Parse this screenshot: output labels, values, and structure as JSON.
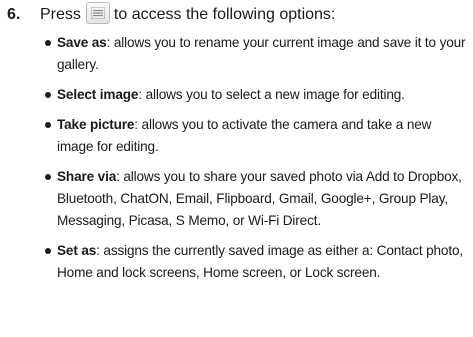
{
  "step": {
    "number": "6.",
    "before_icon": "Press",
    "icon": "menu-key-icon",
    "after_icon": "to access the following options:"
  },
  "options": [
    {
      "term": "Save as",
      "description": ": allows you to rename your current image and save it to your gallery."
    },
    {
      "term": "Select image",
      "description": ": allows you to select a new image for editing."
    },
    {
      "term": "Take picture",
      "description": ": allows you to activate the camera and take a new image for editing."
    },
    {
      "term": "Share via",
      "description": ": allows you to share your saved photo via Add to Dropbox, Bluetooth, ChatON, Email, Flipboard, Gmail, Google+, Group Play, Messaging, Picasa, S Memo, or Wi-Fi Direct."
    },
    {
      "term": "Set as",
      "description": ": assigns the currently saved image as either a: Contact photo, Home and lock screens, Home screen, or Lock screen."
    }
  ]
}
